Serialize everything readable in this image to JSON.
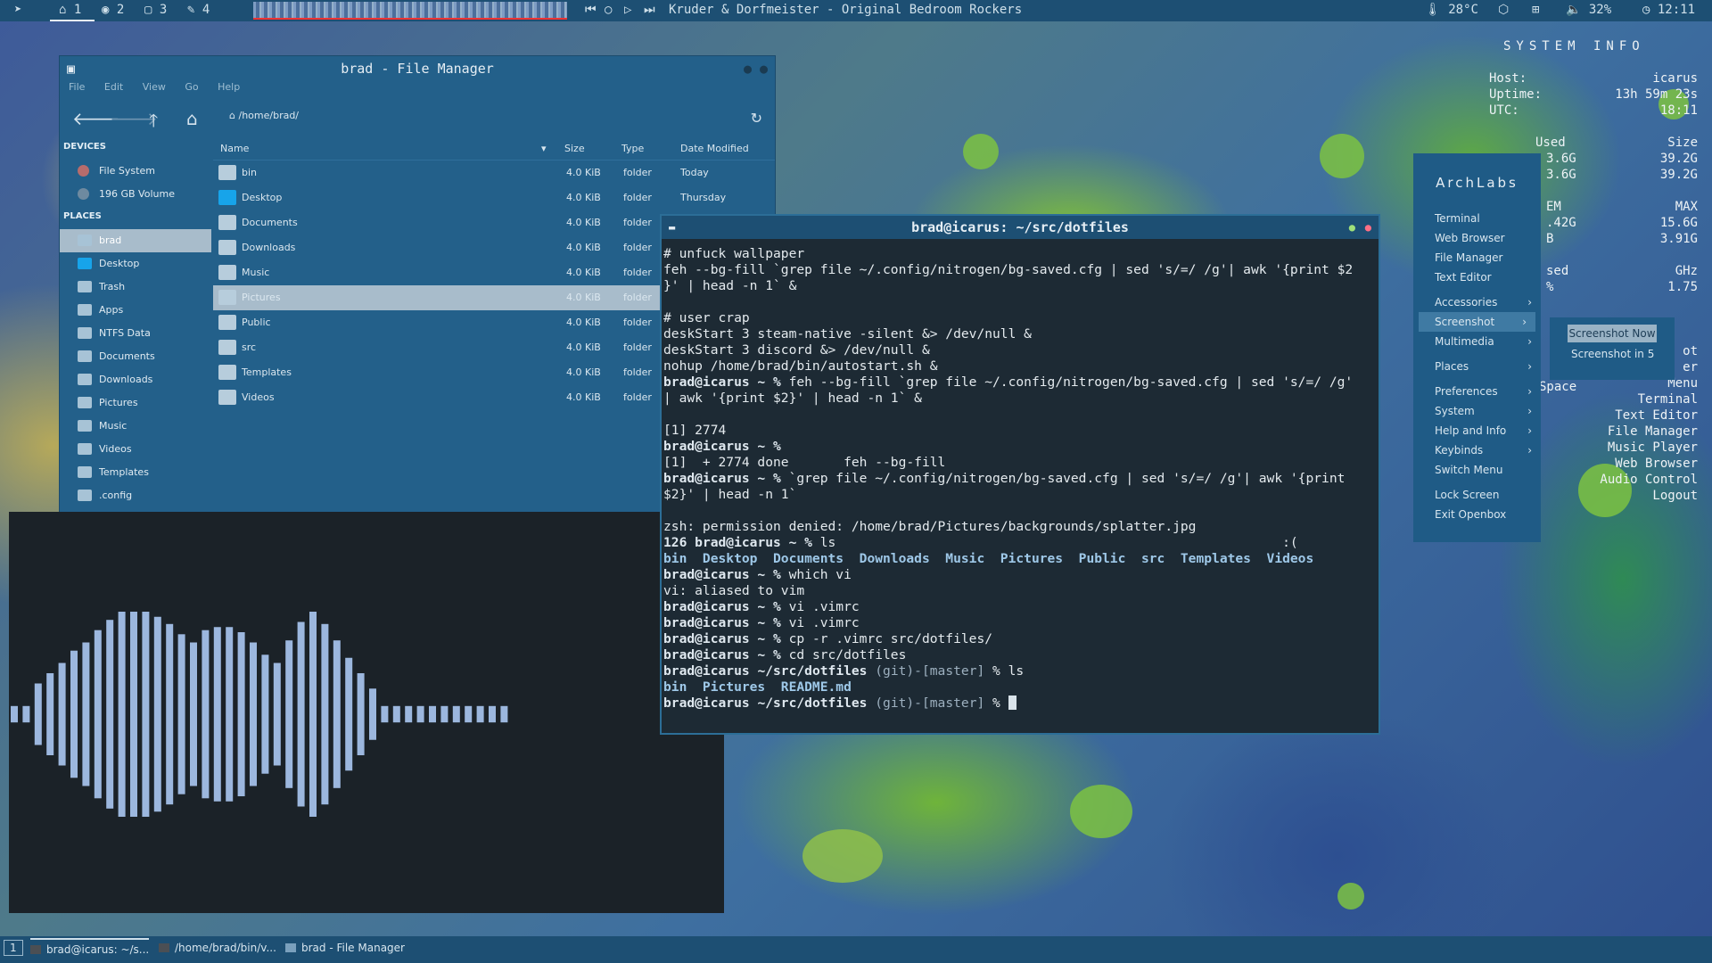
{
  "topbar": {
    "workspaces": [
      {
        "icon": "home-icon",
        "label": "1"
      },
      {
        "icon": "globe-icon",
        "label": "2"
      },
      {
        "icon": "chat-icon",
        "label": "3"
      },
      {
        "icon": "tool-icon",
        "label": "4"
      }
    ],
    "now_playing": "Kruder & Dorfmeister - Original Bedroom Rockers",
    "temperature": "28°C",
    "volume": "32%",
    "clock": "12:11"
  },
  "file_manager": {
    "title": "brad - File Manager",
    "menu": [
      "File",
      "Edit",
      "View",
      "Go",
      "Help"
    ],
    "path": "/home/brad/",
    "sidebar": {
      "devices_header": "DEVICES",
      "devices": [
        "File System",
        "196 GB Volume"
      ],
      "places_header": "PLACES",
      "places": [
        "brad",
        "Desktop",
        "Trash",
        "Apps",
        "NTFS Data",
        "Documents",
        "Downloads",
        "Pictures",
        "Music",
        "Videos",
        "Templates",
        ".config"
      ]
    },
    "columns": [
      "Name",
      "Size",
      "Type",
      "Date Modified"
    ],
    "files": [
      {
        "name": "bin",
        "size": "4.0 KiB",
        "type": "folder",
        "date": "Today"
      },
      {
        "name": "Desktop",
        "size": "4.0 KiB",
        "type": "folder",
        "date": "Thursday"
      },
      {
        "name": "Documents",
        "size": "4.0 KiB",
        "type": "folder",
        "date": ""
      },
      {
        "name": "Downloads",
        "size": "4.0 KiB",
        "type": "folder",
        "date": ""
      },
      {
        "name": "Music",
        "size": "4.0 KiB",
        "type": "folder",
        "date": ""
      },
      {
        "name": "Pictures",
        "size": "4.0 KiB",
        "type": "folder",
        "date": ""
      },
      {
        "name": "Public",
        "size": "4.0 KiB",
        "type": "folder",
        "date": ""
      },
      {
        "name": "src",
        "size": "4.0 KiB",
        "type": "folder",
        "date": ""
      },
      {
        "name": "Templates",
        "size": "4.0 KiB",
        "type": "folder",
        "date": ""
      },
      {
        "name": "Videos",
        "size": "4.0 KiB",
        "type": "folder",
        "date": ""
      }
    ]
  },
  "terminal": {
    "title": "brad@icarus: ~/src/dotfiles",
    "lines": {
      "l1": "# unfuck wallpaper",
      "l2": "feh --bg-fill `grep file ~/.config/nitrogen/bg-saved.cfg | sed 's/=/ /g'| awk '{print $2",
      "l3": "}' | head -n 1` &",
      "l4": "# user crap",
      "l5": "deskStart 3 steam-native -silent &> /dev/null &",
      "l6": "deskStart 3 discord &> /dev/null &",
      "l7": "nohup /home/brad/bin/autostart.sh &",
      "l8_prompt": "brad@icarus ~ %",
      "l8_cmd": " feh --bg-fill `grep file ~/.config/nitrogen/bg-saved.cfg | sed 's/=/ /g'",
      "l9": "| awk '{print $2}' | head -n 1` &",
      "l10": "[1] 2774",
      "l11_prompt": "brad@icarus ~ %",
      "l12": "[1]  + 2774 done       feh --bg-fill",
      "l13_prompt": "brad@icarus ~ %",
      "l13_cmd": " `grep file ~/.config/nitrogen/bg-saved.cfg | sed 's/=/ /g'| awk '{print",
      "l14": "$2}' | head -n 1`",
      "l15": "zsh: permission denied: /home/brad/Pictures/backgrounds/splatter.jpg",
      "l16_code": "126",
      "l16_prompt": "brad@icarus ~ %",
      "l16_cmd": " ls",
      "l16_face": ":(",
      "l17": "bin  Desktop  Documents  Downloads  Music  Pictures  Public  src  Templates  Videos",
      "l18_prompt": "brad@icarus ~ %",
      "l18_cmd": " which vi",
      "l19": "vi: aliased to vim",
      "l20_prompt": "brad@icarus ~ %",
      "l20_cmd": " vi .vimrc",
      "l21_prompt": "brad@icarus ~ %",
      "l21_cmd": " vi .vimrc",
      "l22_prompt": "brad@icarus ~ %",
      "l22_cmd": " cp -r .vimrc src/dotfiles/",
      "l23_prompt": "brad@icarus ~ %",
      "l23_cmd": " cd src/dotfiles",
      "l24_prompt": "brad@icarus",
      "l24_dir": "~/src/dotfiles",
      "l24_git": " (git)-[master]",
      "l24_cmd": " % ls",
      "l25": "bin  Pictures  README.md",
      "l26_prompt": "brad@icarus",
      "l26_dir": "~/src/dotfiles",
      "l26_git": " (git)-[master]",
      "l26_cmd": " % "
    }
  },
  "openbox_menu": {
    "title": "ArchLabs",
    "items": [
      "Terminal",
      "Web Browser",
      "File Manager",
      "Text Editor"
    ],
    "sub_items": [
      "Accessories",
      "Screenshot",
      "Multimedia"
    ],
    "places": "Places",
    "more": [
      "Preferences",
      "System",
      "Help and Info",
      "Keybinds"
    ],
    "switch": "Switch Menu",
    "lock": "Lock Screen",
    "exit": "Exit Openbox",
    "screenshot_sub": [
      "Screenshot Now",
      "Screenshot in 5"
    ]
  },
  "system_info": {
    "title": "SYSTEM   INFO",
    "host_label": "Host:",
    "host": "icarus",
    "uptime_label": "Uptime:",
    "uptime": "13h 59m 23s",
    "utc_label": "UTC:",
    "utc": "18:11",
    "used_label": "Used",
    "size_label": "Size",
    "disk1_used": "3.6G",
    "disk1_size": "39.2G",
    "disk2_used": "3.6G",
    "disk2_size": "39.2G",
    "mem_label": "EM",
    "max_label": "MAX",
    "mem1": ".42G",
    "mem1_max": "15.6G",
    "mem2": "B",
    "mem2_max": "3.91G",
    "cpu_label": "sed",
    "ghz_label": "GHz",
    "cpu_pct": "%",
    "ghz": "1.75",
    "keys": [
      "ot",
      "er",
      "Menu",
      "Terminal",
      "Text Editor",
      "File Manager",
      "Music Player",
      "Web Browser",
      "Audio Control",
      "Logout"
    ],
    "space": "Space"
  },
  "taskbar": {
    "workspace": "1",
    "tasks": [
      "brad@icarus: ~/s...",
      "/home/brad/bin/v...",
      "brad - File Manager"
    ]
  },
  "visualizer": {
    "bar_levels": [
      0.08,
      0.08,
      0.3,
      0.4,
      0.5,
      0.62,
      0.7,
      0.82,
      0.92,
      1,
      1,
      1,
      0.95,
      0.88,
      0.78,
      0.7,
      0.82,
      0.85,
      0.85,
      0.8,
      0.7,
      0.58,
      0.5,
      0.72,
      0.9,
      1,
      0.88,
      0.72,
      0.55,
      0.4,
      0.25,
      0.08,
      0.08,
      0.08,
      0.08,
      0.08,
      0.08,
      0.08,
      0.08,
      0.08,
      0.08,
      0.08
    ],
    "bar_color": "#9cb7de"
  }
}
